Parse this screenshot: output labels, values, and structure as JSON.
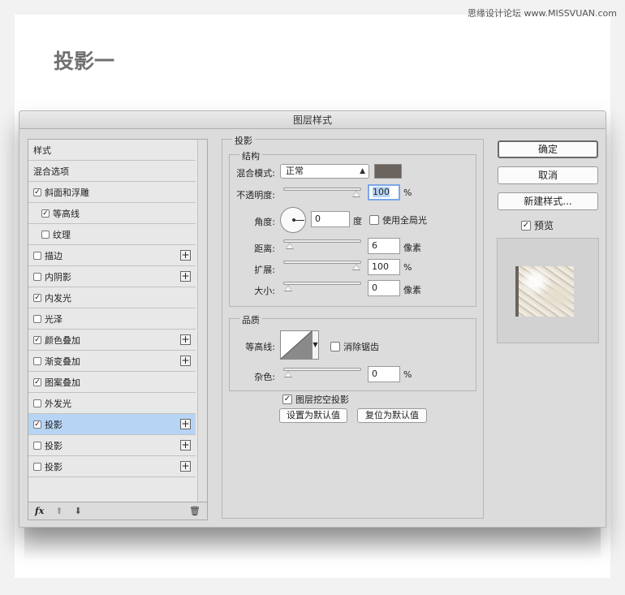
{
  "watermark": "思缘设计论坛 www.MISSVUAN.com",
  "page_title": "投影一",
  "dialog": {
    "title": "图层样式",
    "style_list": [
      {
        "label": "样式",
        "checkbox": false,
        "checked": false,
        "plus": false,
        "indent": false,
        "selected": false
      },
      {
        "label": "混合选项",
        "checkbox": false,
        "checked": false,
        "plus": false,
        "indent": false,
        "selected": false
      },
      {
        "label": "斜面和浮雕",
        "checkbox": true,
        "checked": true,
        "plus": false,
        "indent": false,
        "selected": false
      },
      {
        "label": "等高线",
        "checkbox": true,
        "checked": true,
        "plus": false,
        "indent": true,
        "selected": false
      },
      {
        "label": "纹理",
        "checkbox": true,
        "checked": false,
        "plus": false,
        "indent": true,
        "selected": false
      },
      {
        "label": "描边",
        "checkbox": true,
        "checked": false,
        "plus": true,
        "indent": false,
        "selected": false
      },
      {
        "label": "内阴影",
        "checkbox": true,
        "checked": false,
        "plus": true,
        "indent": false,
        "selected": false
      },
      {
        "label": "内发光",
        "checkbox": true,
        "checked": true,
        "plus": false,
        "indent": false,
        "selected": false
      },
      {
        "label": "光泽",
        "checkbox": true,
        "checked": false,
        "plus": false,
        "indent": false,
        "selected": false
      },
      {
        "label": "颜色叠加",
        "checkbox": true,
        "checked": true,
        "plus": true,
        "indent": false,
        "selected": false
      },
      {
        "label": "渐变叠加",
        "checkbox": true,
        "checked": false,
        "plus": true,
        "indent": false,
        "selected": false
      },
      {
        "label": "图案叠加",
        "checkbox": true,
        "checked": true,
        "plus": false,
        "indent": false,
        "selected": false
      },
      {
        "label": "外发光",
        "checkbox": true,
        "checked": false,
        "plus": false,
        "indent": false,
        "selected": false
      },
      {
        "label": "投影",
        "checkbox": true,
        "checked": true,
        "plus": true,
        "indent": false,
        "selected": true
      },
      {
        "label": "投影",
        "checkbox": true,
        "checked": false,
        "plus": true,
        "indent": false,
        "selected": false
      },
      {
        "label": "投影",
        "checkbox": true,
        "checked": false,
        "plus": true,
        "indent": false,
        "selected": false
      }
    ],
    "footer": {
      "fx": "fx",
      "up_icon": "arrow-up-icon",
      "down_icon": "arrow-down-icon",
      "trash_icon": "trash-icon"
    },
    "drop_shadow": {
      "section_title": "投影",
      "structure_title": "结构",
      "blend_mode_label": "混合模式:",
      "blend_mode_value": "正常",
      "shadow_color": "#6b635e",
      "opacity_label": "不透明度:",
      "opacity_value": "100",
      "opacity_unit": "%",
      "opacity_fraction": 1.0,
      "angle_label": "角度:",
      "angle_value": "0",
      "angle_unit": "度",
      "global_light_label": "使用全局光",
      "global_light_checked": false,
      "distance_label": "距离:",
      "distance_value": "6",
      "distance_unit": "像素",
      "distance_fraction": 0.02,
      "spread_label": "扩展:",
      "spread_value": "100",
      "spread_unit": "%",
      "spread_fraction": 1.0,
      "size_label": "大小:",
      "size_value": "0",
      "size_unit": "像素",
      "size_fraction": 0.0,
      "quality_title": "品质",
      "contour_label": "等高线:",
      "antialias_label": "消除锯齿",
      "antialias_checked": false,
      "noise_label": "杂色:",
      "noise_value": "0",
      "noise_unit": "%",
      "noise_fraction": 0.0,
      "knockout_label": "图层挖空投影",
      "knockout_checked": true,
      "make_default_label": "设置为默认值",
      "reset_default_label": "复位为默认值"
    },
    "buttons": {
      "ok": "确定",
      "cancel": "取消",
      "new_style": "新建样式...",
      "preview_label": "预览",
      "preview_checked": true
    },
    "preview_shadow_color": "#6b635e"
  }
}
